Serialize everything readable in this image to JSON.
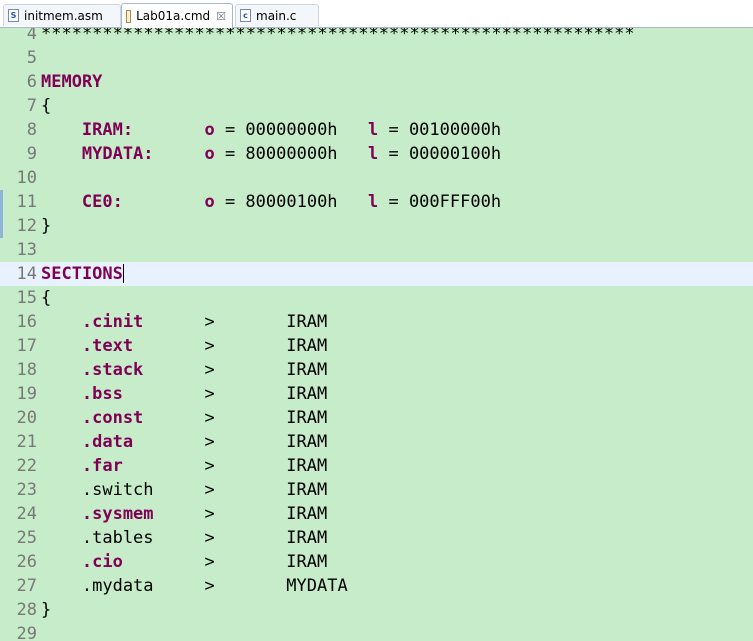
{
  "tabs": [
    {
      "label": "initmem.asm",
      "icon": "asm-file-icon",
      "active": false
    },
    {
      "label": "Lab01a.cmd",
      "icon": "cmd-file-icon",
      "active": true,
      "close": "☒"
    },
    {
      "label": "main.c",
      "icon": "c-file-icon",
      "active": false
    }
  ],
  "icon_glyphs": {
    "asm": "S",
    "cmd": "",
    "c": "c"
  },
  "colors": {
    "editor_bg": "#c6ecc9",
    "keyword": "#7f0055",
    "current_line": "#e8f2fe"
  },
  "editor": {
    "lines": [
      {
        "n": "4",
        "c": "**********************************************************"
      },
      {
        "n": "5",
        "c": ""
      },
      {
        "n": "6",
        "kw": "MEMORY"
      },
      {
        "n": "7",
        "c": "{"
      },
      {
        "n": "8",
        "name": "IRAM:",
        "o": "o",
        "ov": "= 00000000h",
        "l": "l",
        "lv": "= 00100000h"
      },
      {
        "n": "9",
        "name": "MYDATA:",
        "o": "o",
        "ov": "= 80000000h",
        "l": "l",
        "lv": "= 00000100h"
      },
      {
        "n": "10",
        "c": ""
      },
      {
        "n": "11",
        "name": "CE0:",
        "o": "o",
        "ov": "= 80000100h",
        "l": "l",
        "lv": "= 000FFF00h"
      },
      {
        "n": "12",
        "c": "}"
      },
      {
        "n": "13",
        "c": ""
      },
      {
        "n": "14",
        "kw": "SECTIONS",
        "current": true
      },
      {
        "n": "15",
        "c": "{"
      },
      {
        "n": "16",
        "sec": ".cinit",
        "bold": true,
        "arrow": ">",
        "target": "IRAM"
      },
      {
        "n": "17",
        "sec": ".text",
        "bold": true,
        "arrow": ">",
        "target": "IRAM"
      },
      {
        "n": "18",
        "sec": ".stack",
        "bold": true,
        "arrow": ">",
        "target": "IRAM"
      },
      {
        "n": "19",
        "sec": ".bss",
        "bold": true,
        "arrow": ">",
        "target": "IRAM"
      },
      {
        "n": "20",
        "sec": ".const",
        "bold": true,
        "arrow": ">",
        "target": "IRAM"
      },
      {
        "n": "21",
        "sec": ".data",
        "bold": true,
        "arrow": ">",
        "target": "IRAM"
      },
      {
        "n": "22",
        "sec": ".far",
        "bold": true,
        "arrow": ">",
        "target": "IRAM"
      },
      {
        "n": "23",
        "sec": ".switch",
        "bold": false,
        "arrow": ">",
        "target": "IRAM"
      },
      {
        "n": "24",
        "sec": ".sysmem",
        "bold": true,
        "arrow": ">",
        "target": "IRAM"
      },
      {
        "n": "25",
        "sec": ".tables",
        "bold": false,
        "arrow": ">",
        "target": "IRAM"
      },
      {
        "n": "26",
        "sec": ".cio",
        "bold": true,
        "arrow": ">",
        "target": "IRAM"
      },
      {
        "n": "27",
        "sec": ".mydata",
        "bold": false,
        "arrow": ">",
        "target": "MYDATA"
      },
      {
        "n": "28",
        "c": "}"
      },
      {
        "n": "29",
        "c": ""
      }
    ]
  }
}
